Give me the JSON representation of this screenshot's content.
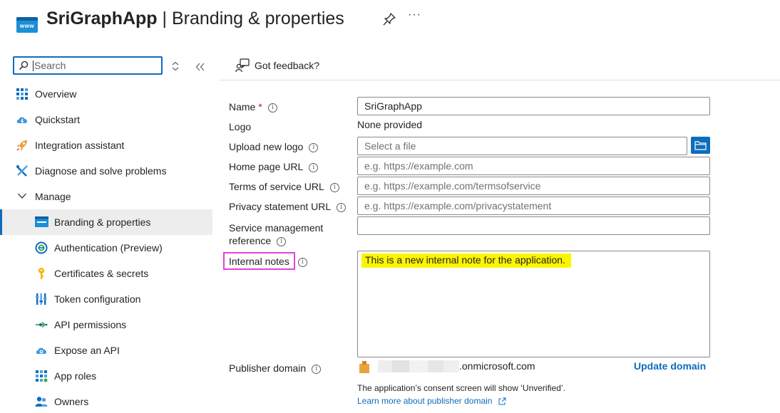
{
  "header": {
    "app_name": "SriGraphApp",
    "separator": "|",
    "page_title": "Branding & properties",
    "app_icon_text": "www",
    "pin_icon": "pin-icon",
    "more_icon": "ellipsis-icon",
    "more_glyph": "···"
  },
  "sidebar": {
    "search_placeholder": "Search",
    "items": [
      {
        "label": "Overview",
        "icon": "grid-icon"
      },
      {
        "label": "Quickstart",
        "icon": "cloud-bolt-icon"
      },
      {
        "label": "Integration assistant",
        "icon": "rocket-icon"
      },
      {
        "label": "Diagnose and solve problems",
        "icon": "wrench-icon"
      },
      {
        "label": "Manage",
        "icon": "chevron-down-icon",
        "expanded": true
      },
      {
        "label": "Branding & properties",
        "icon": "www-icon",
        "active": true
      },
      {
        "label": "Authentication (Preview)",
        "icon": "auth-icon"
      },
      {
        "label": "Certificates & secrets",
        "icon": "key-icon"
      },
      {
        "label": "Token configuration",
        "icon": "token-bars-icon"
      },
      {
        "label": "API permissions",
        "icon": "api-arrow-icon"
      },
      {
        "label": "Expose an API",
        "icon": "cloud-gear-icon"
      },
      {
        "label": "App roles",
        "icon": "app-roles-icon"
      },
      {
        "label": "Owners",
        "icon": "people-icon"
      }
    ]
  },
  "toolbar": {
    "feedback_label": "Got feedback?",
    "feedback_icon": "feedback-person-icon"
  },
  "form": {
    "name_label": "Name",
    "name_required": "*",
    "name_value": "SriGraphApp",
    "logo_label": "Logo",
    "logo_value": "None provided",
    "upload_logo_label": "Upload new logo",
    "upload_logo_placeholder": "Select a file",
    "homepage_label": "Home page URL",
    "homepage_placeholder": "e.g. https://example.com",
    "tos_label": "Terms of service URL",
    "tos_placeholder": "e.g. https://example.com/termsofservice",
    "privacy_label": "Privacy statement URL",
    "privacy_placeholder": "e.g. https://example.com/privacystatement",
    "service_mgmt_label_line1": "Service management",
    "service_mgmt_label_line2": "reference",
    "service_mgmt_value": "",
    "internal_notes_label": "Internal notes",
    "internal_notes_value": "This is a new internal note for the application.",
    "publisher_domain_label": "Publisher domain",
    "publisher_domain_suffix": ".onmicrosoft.com",
    "update_domain_label": "Update domain",
    "consent_text": "The application’s consent screen will show ‘Unverified’.",
    "learn_more_label": "Learn more about publisher domain"
  },
  "colors": {
    "accent": "#0f6cbd",
    "highlight": "#fcf500",
    "annotation_box": "#e83ee0",
    "required": "#c50f1f"
  }
}
